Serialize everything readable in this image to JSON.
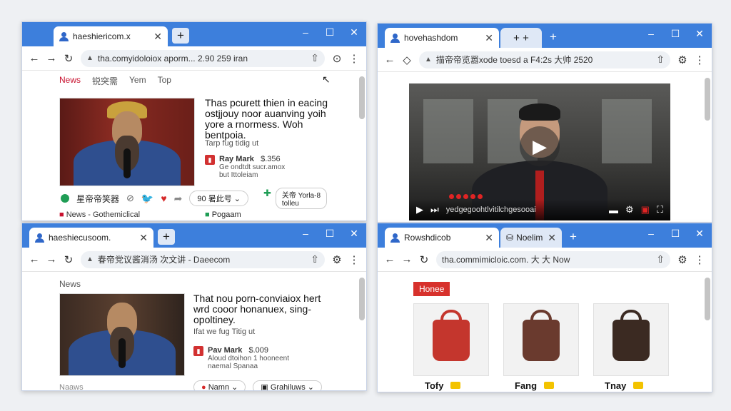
{
  "colors": {
    "chrome_blue": "#3d7fdc",
    "accent_red": "#d7312c",
    "news_red": "#c8102e",
    "bag_red": "#c4362d",
    "bag_brown": "#6a3a2e",
    "bag_dark": "#3b2a22"
  },
  "windows": [
    {
      "tab_title": "haeshiericom.x",
      "url": "tha.comyidoloiox aporm... 2.90 259 iran",
      "nav": [
        "News",
        "锐突需",
        "Yem",
        "Top"
      ],
      "headline": "Thas pcurett thien in eacing ostjjouy noor auanving yoih yore a rnormess. Woh bentpoia.",
      "meta": "Tarp fug tidig ut",
      "author_name": "Ray Mark",
      "author_price": "$.356",
      "author_sub": "Ge ondtdt sucr.amox\nbut Ittoleiam",
      "actions": [
        "星帝帝笑器",
        "90 暑此号"
      ],
      "promo_label": "关帝 Yorla-8\ntolleu",
      "footer": "News - Gothemiclical",
      "footer2": "Pogaam"
    },
    {
      "tab_title": "hovehashdom",
      "tab2_title": "+ +",
      "url": "描帝帝览嚣xode toesd a F4:2s 大帅 2520",
      "video_caption": "yedgegoohtlvitilchgesooai"
    },
    {
      "tab_title": "haeshiecusoom.",
      "url": "春帝党议酱消汤 次文讲 - Daeecom",
      "nav": [
        "News"
      ],
      "headline": "That nou porn-conviaiox hert wrd cooor honanuex, sing- opoltiney.",
      "meta": "Ifat we fug Titig ut",
      "author_name": "Pav Mark",
      "author_price": "$.009",
      "author_sub": "Aloud dtoihon 1 hooneent\nnaemal Spanaa",
      "actions": [
        "Namn",
        "Grahiluws"
      ],
      "footer": "Naaws"
    },
    {
      "tab_title": "Rowshdicob",
      "tab2_title": "Noelim",
      "url": "tha.commimicloic.com. 大 大 Now",
      "badge": "Honee",
      "products": [
        "Tofy",
        "Fang",
        "Tnay"
      ]
    }
  ]
}
